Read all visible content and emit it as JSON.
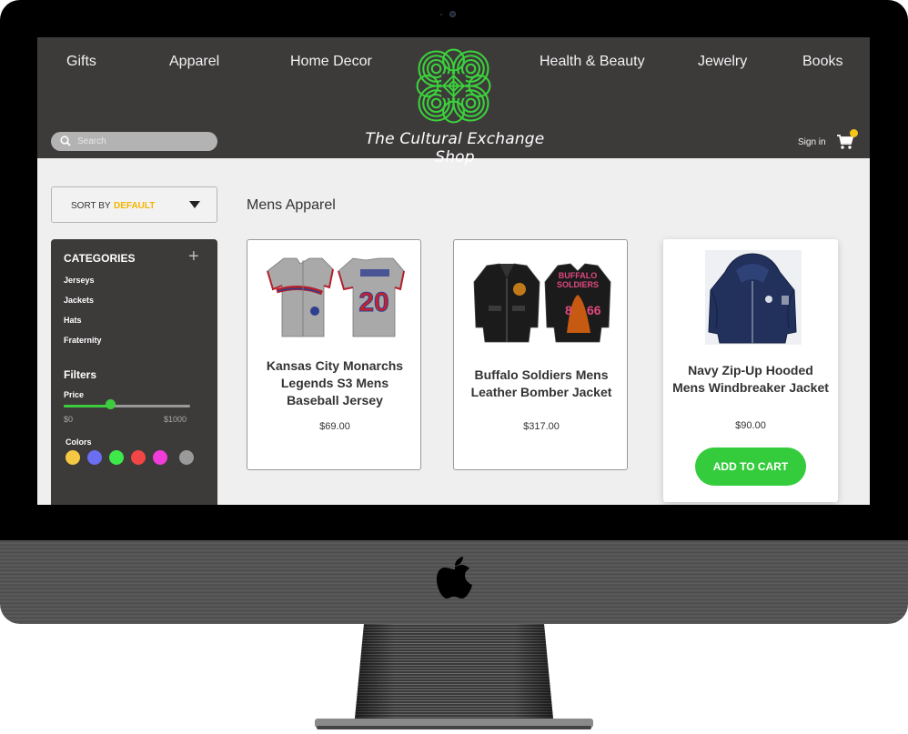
{
  "store": {
    "title": "The Cultural Exchange Shop",
    "nav": [
      "Gifts",
      "Apparel",
      "Home Decor",
      "Health & Beauty",
      "Jewelry",
      "Books"
    ],
    "search_placeholder": "Search",
    "signin_label": "Sign in"
  },
  "sort": {
    "label": "SORT BY",
    "value": "DEFAULT"
  },
  "sidebar": {
    "categories_title": "CATEGORIES",
    "categories": [
      "Jerseys",
      "Jackets",
      "Hats",
      "Fraternity"
    ],
    "filters_title": "Filters",
    "price": {
      "label": "Price",
      "min_label": "$0",
      "max_label": "$1000",
      "level": 0.37
    },
    "colors_label": "Colors",
    "colors": [
      "#f5c842",
      "#6b6ef0",
      "#3ee84a",
      "#f24646",
      "#f03cd8",
      "#9a9a9a"
    ]
  },
  "main": {
    "section_title": "Mens Apparel",
    "products": [
      {
        "name": "Kansas City Monarchs Legends S3 Mens Baseball Jersey",
        "price": "$69.00"
      },
      {
        "name": "Buffalo Soldiers Mens Leather Bomber Jacket",
        "price": "$317.00"
      },
      {
        "name": "Navy Zip-Up Hooded Mens Windbreaker Jacket",
        "price": "$90.00"
      }
    ],
    "add_to_cart_label": "ADD TO CART"
  },
  "theme": {
    "header_bg": "#3d3a3a",
    "accent_green": "#34cc3c",
    "accent_yellow": "#f5c518",
    "logo_green": "#3bd23b"
  }
}
